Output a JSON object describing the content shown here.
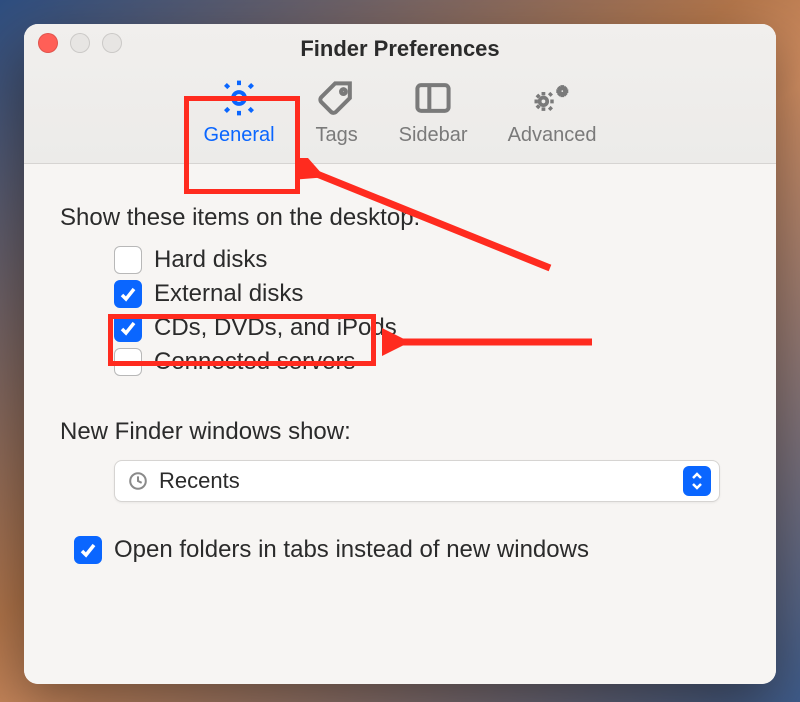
{
  "window": {
    "title": "Finder Preferences"
  },
  "tabs": {
    "general": "General",
    "tags": "Tags",
    "sidebar": "Sidebar",
    "advanced": "Advanced"
  },
  "sections": {
    "show_on_desktop": "Show these items on the desktop:",
    "items": {
      "hard_disks": {
        "label": "Hard disks",
        "checked": false
      },
      "external_disks": {
        "label": "External disks",
        "checked": true
      },
      "cds_dvds_ipods": {
        "label": "CDs, DVDs, and iPods",
        "checked": true
      },
      "connected_servers": {
        "label": "Connected servers",
        "checked": false
      }
    },
    "new_window": {
      "label": "New Finder windows show:",
      "selected": "Recents"
    },
    "open_folders": {
      "label": "Open folders in tabs instead of new windows",
      "checked": true
    }
  },
  "annotations": {
    "highlight": [
      "general-tab",
      "external-disks-row"
    ],
    "colors": {
      "highlight": "#ff2b1f",
      "accent": "#0a66ff"
    }
  }
}
